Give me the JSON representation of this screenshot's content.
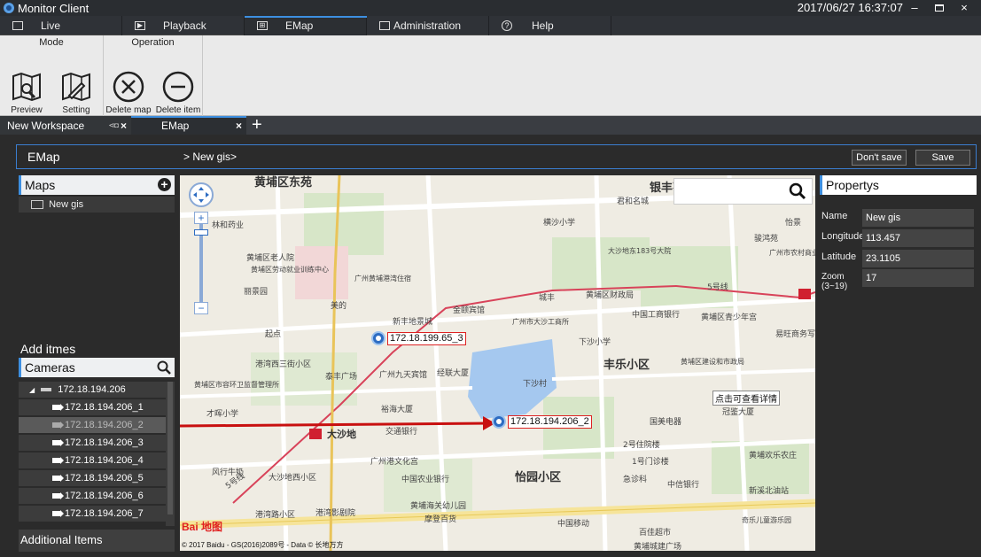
{
  "window": {
    "title": "Monitor Client",
    "datetime": "2017/06/27 16:37:07",
    "controls": [
      "–",
      "▬",
      "×"
    ]
  },
  "main_tabs": [
    {
      "label": "Live",
      "icon": "monitor-icon"
    },
    {
      "label": "Playback",
      "icon": "play-icon"
    },
    {
      "label": "EMap",
      "icon": "map-icon",
      "active": true
    },
    {
      "label": "Administration",
      "icon": "folder-icon"
    },
    {
      "label": "Help",
      "icon": "help-icon"
    }
  ],
  "ribbon": {
    "groups": [
      {
        "title": "Mode",
        "buttons": [
          "Preview",
          "Setting"
        ]
      },
      {
        "title": "Operation",
        "buttons": [
          "Delete map",
          "Delete item"
        ]
      }
    ]
  },
  "workspace_tabs": [
    {
      "label": "New Workspace"
    },
    {
      "label": "EMap",
      "active": true
    }
  ],
  "header": {
    "title": "EMap",
    "breadcrumb": "> New gis>",
    "dont_save": "Don't save",
    "save": "Save"
  },
  "maps": {
    "title": "Maps",
    "items": [
      "New gis"
    ]
  },
  "add_items": {
    "title": "Add itmes",
    "cameras_title": "Cameras",
    "device": "172.18.194.206",
    "channels": [
      "172.18.194.206_1",
      "172.18.194.206_2",
      "172.18.194.206_3",
      "172.18.194.206_4",
      "172.18.194.206_5",
      "172.18.194.206_6",
      "172.18.194.206_7"
    ],
    "additional": "Additional Items"
  },
  "map": {
    "markers": [
      "172.18.199.65_3",
      "172.18.194.206_2"
    ],
    "tooltip": "点击可查看详情",
    "copyright": "© 2017 Baidu - GS(2016)2089号 - Data © 长地万方",
    "logo": "Bai 地图",
    "labels": {
      "district_top": "黄埔区东苑",
      "bank_top": "银丰花园",
      "fengle": "丰乐小区",
      "yiyuan": "怡园小区",
      "dashadi": "大沙地",
      "xiasha": "下沙村",
      "xinfeng": "新丰地景城",
      "line5": "5号线",
      "line5b": "5号线",
      "icbc": "中国工商银行",
      "huangpu_gov": "黄埔区财政局",
      "youth": "黄埔区青少年宫",
      "school_heng": "横沙小学",
      "school_xia": "下沙小学",
      "lianhe": "林和药业",
      "laoren": "黄埔区老人院",
      "laodong": "黄埔区劳动就业训练中心",
      "lijing": "丽景园",
      "qidian": "起点",
      "gangwan": "港湾西三街小区",
      "taifeng": "泰丰广场",
      "jiutian": "广州九天宾馆",
      "jingfeng": "经联大厦",
      "yuhai": "裕海大厦",
      "jiaotong": "交通银行",
      "wenhua": "广州港文化宫",
      "nongye": "中国农业银行",
      "zhongxin": "中信银行",
      "guomei": "国美电器",
      "guanjian": "冠鉴大厦",
      "dashadong": "大沙地东183号大院",
      "nongcun": "广州市农村商业银行",
      "jinyi": "金颐宾馆",
      "chengfeng": "城丰",
      "kid": "奇乐儿童游乐园",
      "yidong": "中国移动",
      "baijia": "百佳超市",
      "mall": "黄埔城建广场",
      "yiwu": "易旺商务写",
      "jianshe": "黄埔区建设和市政局",
      "huanle": "黄埔欢乐农庄",
      "xinhuang": "新溪北油站",
      "fenglu": "风行牛奶",
      "dasha_west": "大沙地西小区",
      "gangwan_road": "港湾路小区",
      "cinema": "港湾影剧院",
      "tianye": "黄埔海关幼儿园",
      "mobao": "摩登百货",
      "zhongxi": "广州黄埔港湾住宿",
      "meide": "美的",
      "tuanqu": "黄埔区市容环卫监督管理所",
      "caixiao": "才晖小学",
      "jun": "骏鸿苑",
      "yijin": "怡景",
      "junhe": "君和名城",
      "hospital": "2号住院楼",
      "hospital1": "1号门诊楼",
      "jizhen": "急诊科",
      "xiasha_shi": "广州市大沙工商所"
    }
  },
  "properties": {
    "title": "Propertys",
    "rows": [
      {
        "key": "Name",
        "value": "New gis"
      },
      {
        "key": "Longitude",
        "value": "113.457"
      },
      {
        "key": "Latitude",
        "value": "23.1105"
      },
      {
        "key": "Zoom\n(3~19)",
        "value": "17"
      }
    ]
  }
}
